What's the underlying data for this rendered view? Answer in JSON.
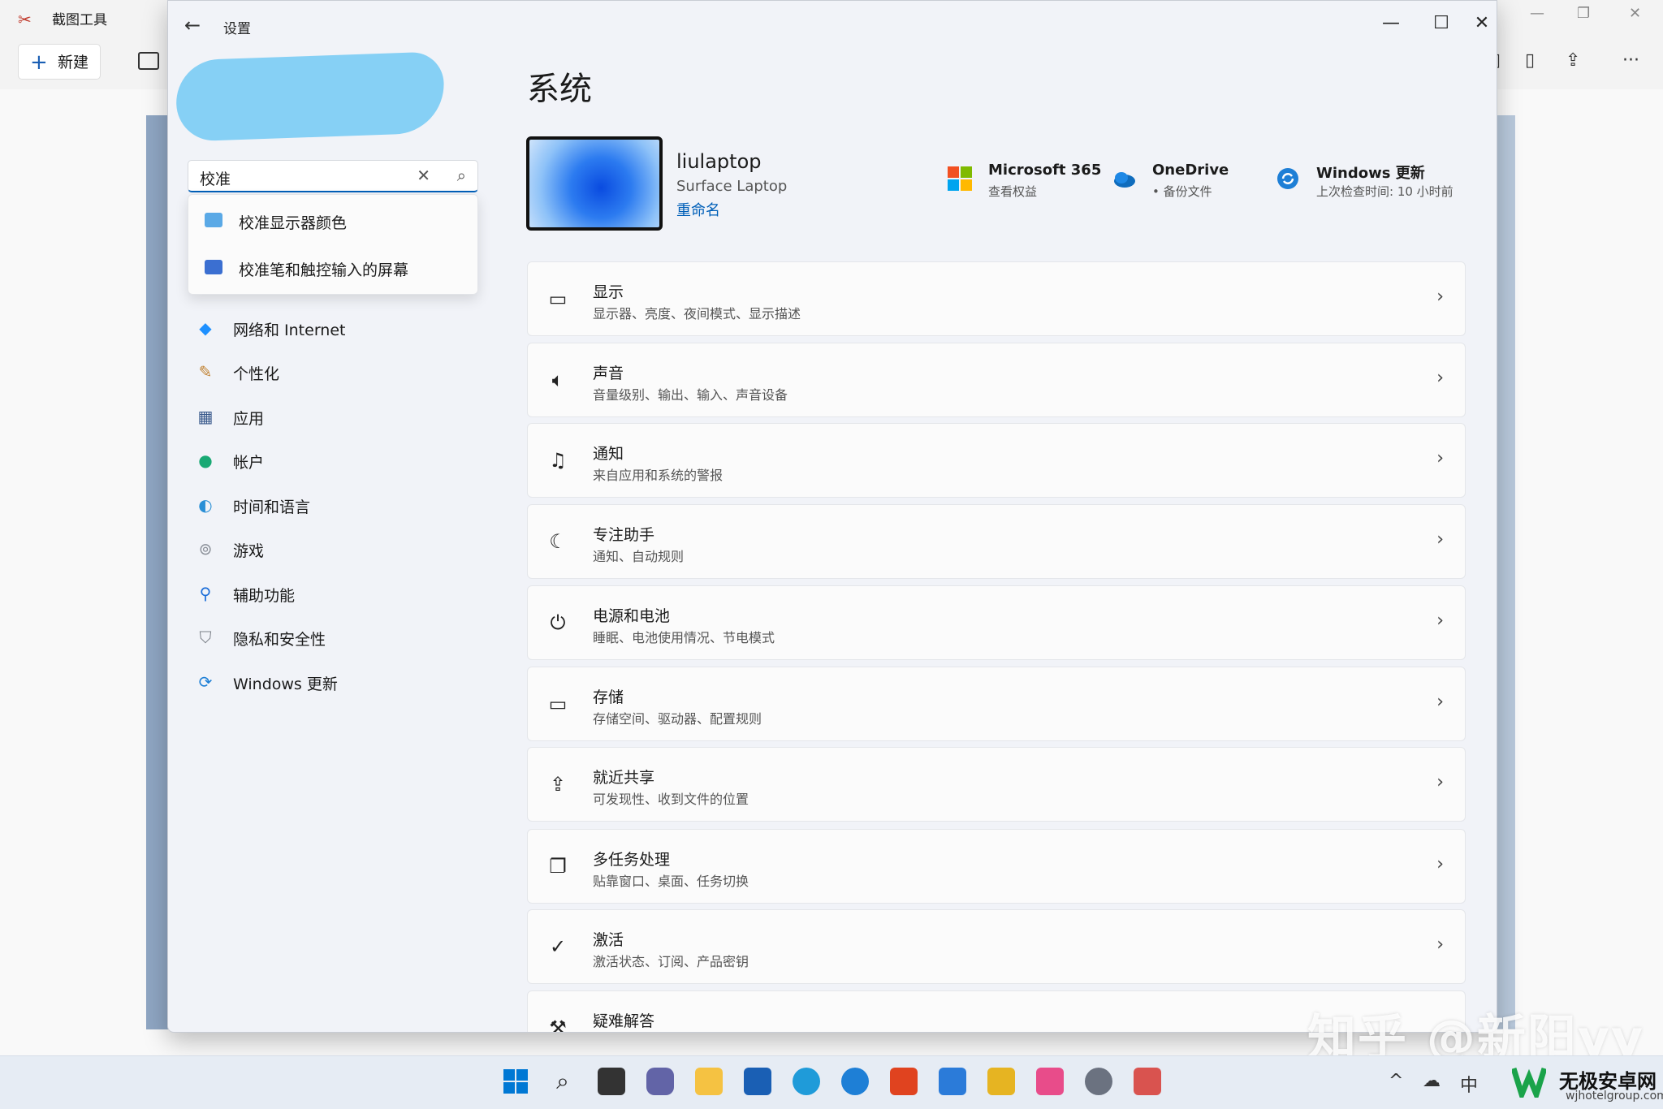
{
  "snip": {
    "title": "截图工具",
    "new_label": "新建"
  },
  "settings": {
    "window_title": "设置",
    "page_title": "系统",
    "search": {
      "value": "校准"
    },
    "suggestions": [
      {
        "label": "校准显示器颜色"
      },
      {
        "label": "校准笔和触控输入的屏幕"
      }
    ],
    "nav": [
      {
        "label": "网络和 Internet",
        "icon": "wifi-icon"
      },
      {
        "label": "个性化",
        "icon": "brush-icon"
      },
      {
        "label": "应用",
        "icon": "apps-icon"
      },
      {
        "label": "帐户",
        "icon": "account-icon"
      },
      {
        "label": "时间和语言",
        "icon": "globe-clock-icon"
      },
      {
        "label": "游戏",
        "icon": "gamepad-icon"
      },
      {
        "label": "辅助功能",
        "icon": "accessibility-icon"
      },
      {
        "label": "隐私和安全性",
        "icon": "shield-icon"
      },
      {
        "label": "Windows 更新",
        "icon": "update-icon"
      }
    ],
    "device": {
      "name": "liulaptop",
      "model": "Surface Laptop",
      "rename": "重命名"
    },
    "quick_links": [
      {
        "title": "Microsoft 365",
        "sub": "查看权益",
        "icon": "microsoft-logo-icon"
      },
      {
        "title": "OneDrive",
        "sub": "• 备份文件",
        "icon": "onedrive-cloud-icon"
      },
      {
        "title": "Windows 更新",
        "sub": "上次检查时间: 10 小时前",
        "icon": "windows-update-icon"
      }
    ],
    "cards": [
      {
        "title": "显示",
        "sub": "显示器、亮度、夜间模式、显示描述",
        "icon": "monitor-icon"
      },
      {
        "title": "声音",
        "sub": "音量级别、输出、输入、声音设备",
        "icon": "speaker-icon"
      },
      {
        "title": "通知",
        "sub": "来自应用和系统的警报",
        "icon": "bell-icon"
      },
      {
        "title": "专注助手",
        "sub": "通知、自动规则",
        "icon": "moon-icon"
      },
      {
        "title": "电源和电池",
        "sub": "睡眠、电池使用情况、节电模式",
        "icon": "power-icon"
      },
      {
        "title": "存储",
        "sub": "存储空间、驱动器、配置规则",
        "icon": "storage-icon"
      },
      {
        "title": "就近共享",
        "sub": "可发现性、收到文件的位置",
        "icon": "share-icon"
      },
      {
        "title": "多任务处理",
        "sub": "贴靠窗口、桌面、任务切换",
        "icon": "multitask-icon"
      },
      {
        "title": "激活",
        "sub": "激活状态、订阅、产品密钥",
        "icon": "check-circle-icon"
      },
      {
        "title": "疑难解答",
        "sub": "",
        "icon": "wrench-icon"
      }
    ]
  },
  "taskbar": {
    "ime": "中"
  },
  "watermark": {
    "zhihu": "知乎 @新阳yy",
    "site_name": "无极安卓网",
    "site_url": "wjhotelgroup.com"
  },
  "colors": {
    "accent": "#005fb8",
    "window_bg": "#f1f3f8",
    "card_bg": "#fbfbfb"
  }
}
